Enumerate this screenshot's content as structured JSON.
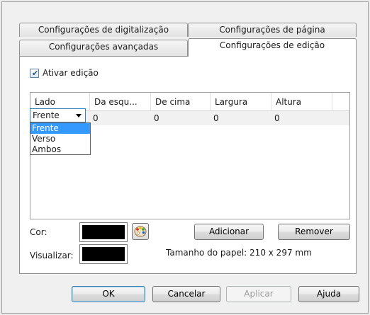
{
  "tabs": {
    "row_back": [
      {
        "label": "Configurações de digitalização"
      },
      {
        "label": "Configurações de página"
      }
    ],
    "row_front": [
      {
        "label": "Configurações avançadas"
      },
      {
        "label": "Configurações de edição"
      }
    ]
  },
  "enable_edit": {
    "label": "Ativar edição",
    "checked": true
  },
  "grid": {
    "columns": [
      "Lado",
      "Da esqu...",
      "De cima",
      "Largura",
      "Altura"
    ],
    "row": {
      "side": "Frente",
      "left": "0",
      "top": "0",
      "width": "0",
      "height": "0"
    }
  },
  "side_dropdown": {
    "options": [
      "Frente",
      "Verso",
      "Ambos"
    ],
    "selected": "Frente"
  },
  "color": {
    "label": "Cor:",
    "value": "#000000"
  },
  "preview": {
    "label": "Visualizar:"
  },
  "paper_size": "Tamanho do papel: 210 x 297 mm",
  "buttons": {
    "add": "Adicionar",
    "remove": "Remover",
    "ok": "OK",
    "cancel": "Cancelar",
    "apply": "Aplicar",
    "help": "Ajuda"
  }
}
